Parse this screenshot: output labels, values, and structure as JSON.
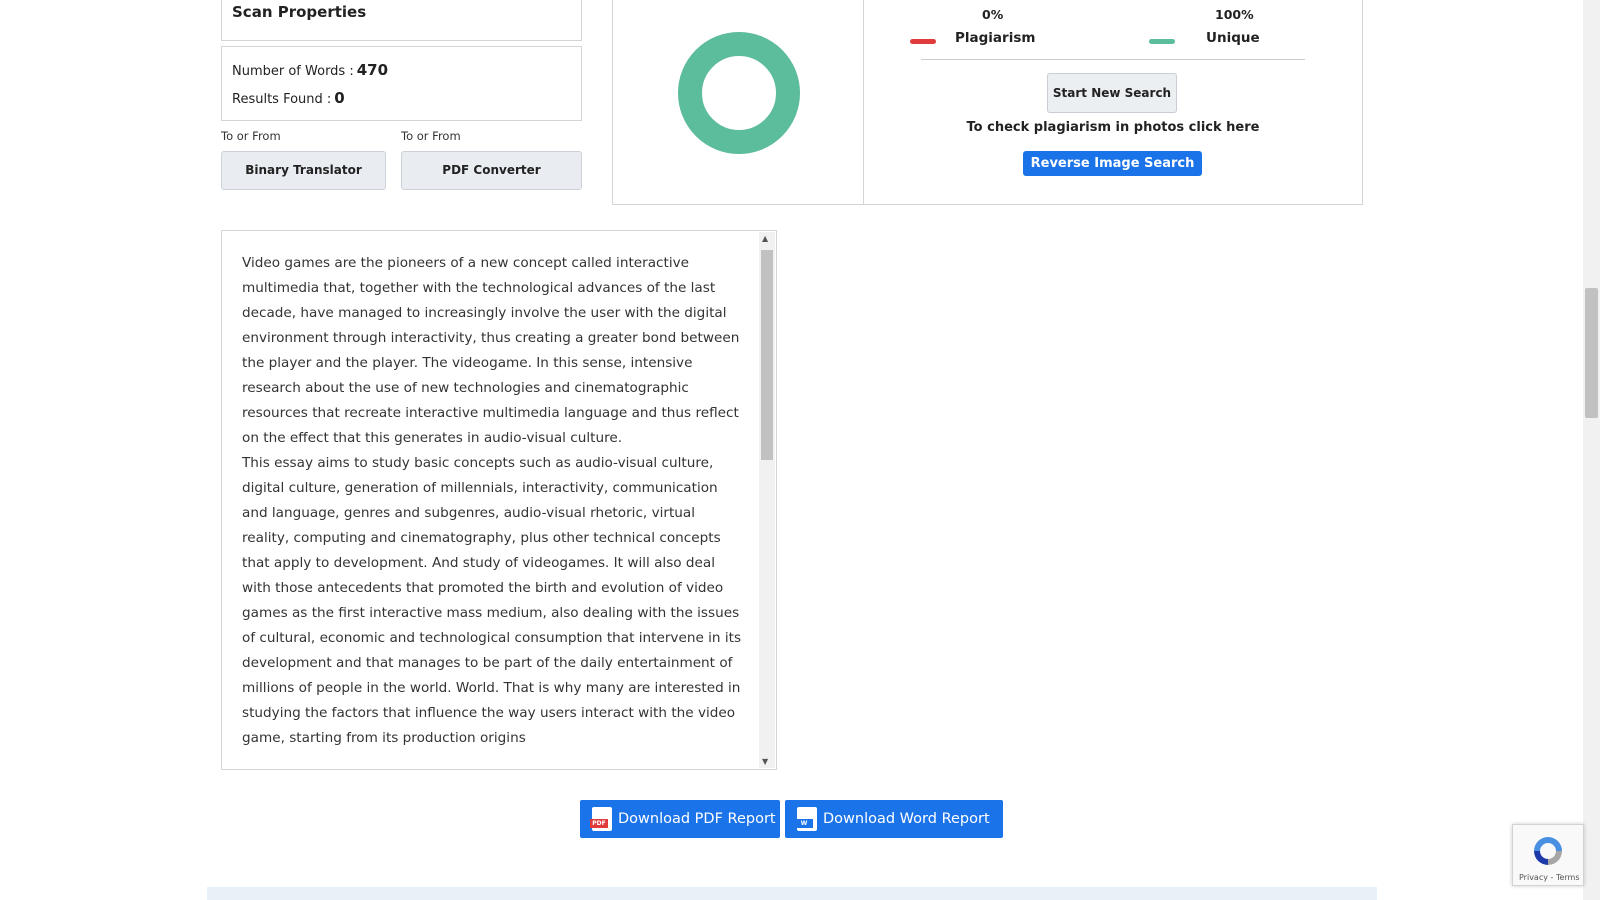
{
  "scan": {
    "title": "Scan Properties",
    "words_label": "Number of Words :",
    "words_value": "470",
    "results_label": "Results Found :",
    "results_value": "0"
  },
  "tools": [
    {
      "label": "To or From",
      "button": "Binary Translator"
    },
    {
      "label": "To or From",
      "button": "PDF Converter"
    }
  ],
  "result": {
    "plagiarism_pct": "0%",
    "plagiarism_label": "Plagiarism",
    "unique_pct": "100%",
    "unique_label": "Unique",
    "start_new_label": "Start New Search",
    "photo_hint": "To check plagiarism in photos click here",
    "reverse_label": "Reverse Image Search",
    "plagiarism_fraction": 0,
    "unique_fraction": 1
  },
  "text": {
    "paragraph1": "Video games are the pioneers of a new concept called interactive multimedia that, together with the technological advances of the last decade, have managed to increasingly involve the user with the digital environment through interactivity, thus creating a greater bond between the player and the player. The videogame. In this sense, intensive research about the use of new technologies and cinematographic resources that recreate interactive multimedia language and thus reflect on the effect that this generates in audio-visual culture.",
    "paragraph2": "This essay aims to study basic concepts such as audio-visual culture, digital culture, generation of millennials, interactivity, communication and language, genres and subgenres, audio-visual rhetoric, virtual reality, computing and cinematography, plus other technical concepts that apply to development. And study of videogames. It will also deal with those antecedents that promoted the birth and evolution of video games as the first interactive mass medium, also dealing with the issues of cultural, economic and technological consumption that intervene in its development and that manages to be part of the daily entertainment of millions of people in the world. World. That is why many are interested in studying the factors that influence the way users interact with the video game, starting from its production origins"
  },
  "downloads": {
    "pdf_label": "Download PDF Report",
    "pdf_tag": "PDF",
    "word_label": "Download Word Report",
    "word_tag": "W"
  },
  "recaptcha": {
    "links": "Privacy - Terms"
  },
  "colors": {
    "unique": "#5bbd9b",
    "plagiarism": "#e03a3a",
    "primary": "#1a73e8"
  }
}
